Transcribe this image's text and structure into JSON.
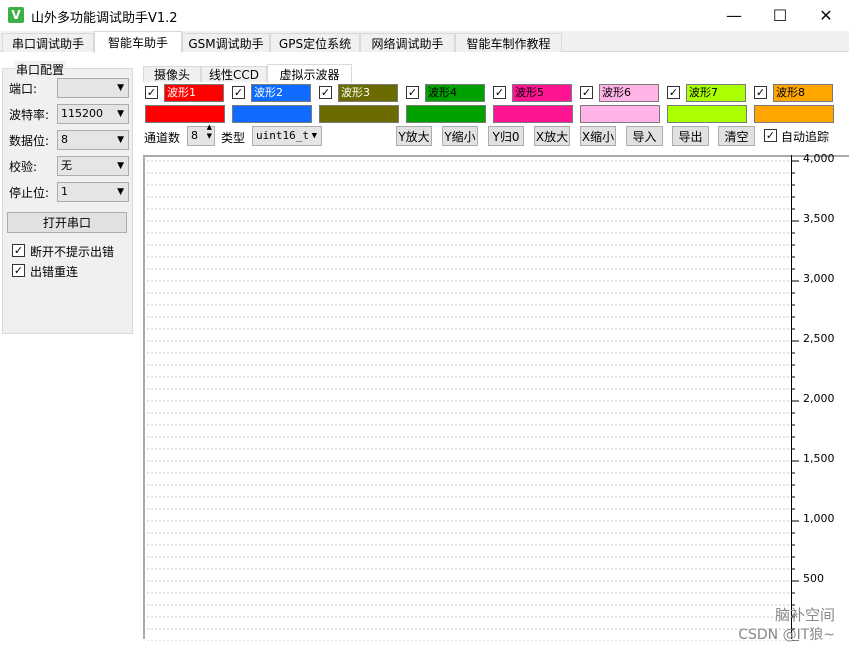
{
  "window": {
    "title": "山外多功能调试助手V1.2",
    "icon_glyph": "V",
    "minimize": "—",
    "maximize": "☐",
    "close": "✕"
  },
  "main_tabs": [
    {
      "label": "串口调试助手"
    },
    {
      "label": "智能车助手"
    },
    {
      "label": "GSM调试助手"
    },
    {
      "label": "GPS定位系统"
    },
    {
      "label": "网络调试助手"
    },
    {
      "label": "智能车制作教程"
    }
  ],
  "serial_config": {
    "title": "串口配置",
    "port_label": "端口:",
    "port_value": "",
    "baud_label": "波特率:",
    "baud_value": "115200",
    "databits_label": "数据位:",
    "databits_value": "8",
    "parity_label": "校验:",
    "parity_value": "无",
    "stopbits_label": "停止位:",
    "stopbits_value": "1",
    "open_button": "打开串口",
    "no_prompt_label": "断开不提示出错",
    "reconnect_label": "出错重连",
    "no_prompt_checked": true,
    "reconnect_checked": true
  },
  "sub_tabs": [
    {
      "label": "摄像头"
    },
    {
      "label": "线性CCD"
    },
    {
      "label": "虚拟示波器"
    }
  ],
  "waves": [
    {
      "label": "波形1",
      "color": "#ff0000",
      "text_color": "#ffffff",
      "checked": true
    },
    {
      "label": "波形2",
      "color": "#0f6bff",
      "text_color": "#ffffff",
      "checked": true
    },
    {
      "label": "波形3",
      "color": "#6b6b00",
      "text_color": "#ffffff",
      "checked": true
    },
    {
      "label": "波形4",
      "color": "#00a000",
      "text_color": "#000000",
      "checked": true
    },
    {
      "label": "波形5",
      "color": "#ff1493",
      "text_color": "#000000",
      "checked": true
    },
    {
      "label": "波形6",
      "color": "#ffb3e6",
      "text_color": "#000000",
      "checked": true
    },
    {
      "label": "波形7",
      "color": "#aaff00",
      "text_color": "#000000",
      "checked": true
    },
    {
      "label": "波形8",
      "color": "#ffa500",
      "text_color": "#000000",
      "checked": true
    }
  ],
  "controls": {
    "channel_label": "通道数",
    "channel_value": "8",
    "type_label": "类型",
    "type_value": "uint16_t",
    "y_zoom_in": "Y放大",
    "y_zoom_out": "Y缩小",
    "y_reset": "Y归0",
    "x_zoom_in": "X放大",
    "x_zoom_out": "X缩小",
    "import": "导入",
    "export": "导出",
    "clear": "清空",
    "auto_track": "自动追踪",
    "auto_track_checked": true
  },
  "chart_data": {
    "type": "line",
    "series": [],
    "ylim": [
      0,
      4000
    ],
    "ytick_labels": [
      "4,000",
      "3,500",
      "3,000",
      "2,500",
      "2,000",
      "1,500",
      "1,000",
      "500"
    ],
    "ytick_values": [
      4000,
      3500,
      3000,
      2500,
      2000,
      1500,
      1000,
      500
    ],
    "grid": true
  },
  "watermark": {
    "line1": "脑补空间",
    "line2": "CSDN @IT狼~"
  }
}
